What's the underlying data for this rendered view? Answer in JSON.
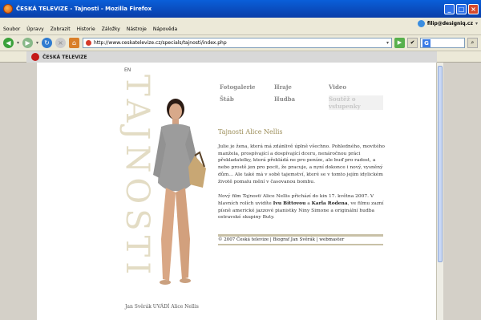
{
  "window": {
    "title": "ČESKÁ TELEVIZE - Tajnosti - Mozilla Firefox",
    "btn_min": "_",
    "btn_max": "□",
    "btn_close": "×"
  },
  "menu": {
    "items": [
      "Soubor",
      "Úpravy",
      "Zobrazit",
      "Historie",
      "Záložky",
      "Nástroje",
      "Nápověda"
    ],
    "user": "filip@designiq.cz"
  },
  "nav": {
    "url": "http://www.ceskatelevize.cz/specials/tajnosti/index.php",
    "back_icon": "◀",
    "fwd_icon": "▶",
    "reload_icon": "↻",
    "home_icon": "⌂",
    "go_icon": "▶",
    "search_icon": "G"
  },
  "site_header": {
    "brand": "ČESKÁ TELEVIZE"
  },
  "page": {
    "lang_link": "EN",
    "big_title": "TAJNOSTI",
    "links": [
      "Fotogalerie",
      "Hraje",
      "Video",
      "Štáb",
      "Hudba",
      "Soutěž o vstupenky"
    ],
    "heading": "Tajnosti Alice Nellis",
    "para1": "Julie je žena, která má zdánlivě úplně všechno. Pohledného, movitého manžela, prospívající a dospívající dceru, nenáročnou práci překladatelky, která překládá ne pro peníze, ale buď pro radost, a nebo prostě jen pro pocit, že pracuje, a nyní dokonce i nový, vysněný dům… Ale také má v sobě tajemství, které se v tomto jejím idylickém životě pomalu mění v časovanou bombu.",
    "para2_a": "Nový film ",
    "para2_italic": "Tajnosti",
    "para2_b": " Alice Nellis přichází do kin 17. května 2007. V hlavních rolích uvidíte ",
    "actor1": "Ivu Bittovou",
    "para2_c": " a ",
    "actor2": "Karla Rodena",
    "para2_d": ", ve filmu zazní písně americké jazzové pianistky Niny Simone a originální hudba ostravské skupiny Buty.",
    "footer": "© 2007 Česká televize | Biograf Jan Svěrák | webmaster",
    "credit": "Jan Svěrák UVÁDÍ Alice Nellis"
  },
  "colors": {
    "accent_gold": "#9a8b55",
    "titlebar_blue": "#0a5fd9",
    "ct_red": "#c41818"
  }
}
